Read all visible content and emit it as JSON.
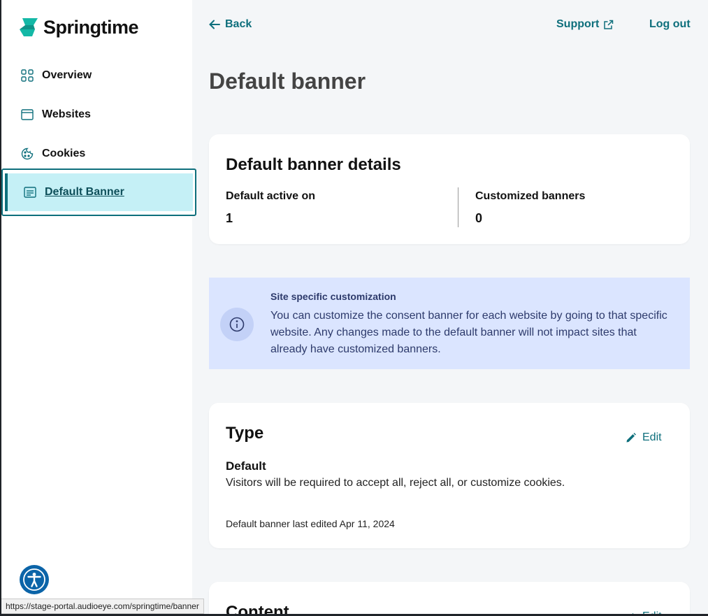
{
  "brand": {
    "name": "Springtime",
    "accent": "#0e6f7c",
    "logo_color": "#14b8a6"
  },
  "sidebar": {
    "items": [
      {
        "label": "Overview",
        "icon": "grid-icon"
      },
      {
        "label": "Websites",
        "icon": "browser-window-icon"
      },
      {
        "label": "Cookies",
        "icon": "cookie-icon"
      },
      {
        "label": "Default Banner",
        "icon": "banner-icon",
        "active": true
      }
    ],
    "accessibility_icon": "accessibility-icon"
  },
  "topbar": {
    "back_label": "Back",
    "support_label": "Support",
    "logout_label": "Log out"
  },
  "page": {
    "title": "Default banner"
  },
  "details": {
    "title": "Default banner details",
    "active_label": "Default active on",
    "active_value": "1",
    "customized_label": "Customized banners",
    "customized_value": "0"
  },
  "info": {
    "title": "Site specific customization",
    "text": "You can customize the consent banner for each website by going to that specific website. Any changes made to the default banner will not impact sites that already have customized banners."
  },
  "type_card": {
    "title": "Type",
    "edit_label": "Edit",
    "type_name": "Default",
    "type_description": "Visitors will be required to accept all, reject all, or customize cookies.",
    "last_edited": "Default banner last edited Apr 11, 2024"
  },
  "content_card": {
    "title": "Content",
    "edit_label": "Edit"
  },
  "status_url": "https://stage-portal.audioeye.com/springtime/banner"
}
